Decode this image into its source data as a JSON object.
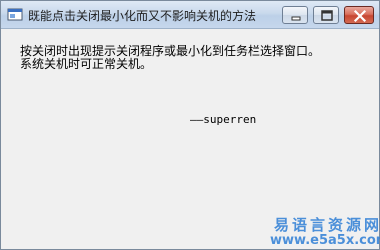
{
  "window": {
    "title": "既能点击关闭最小化而又不影响关机的方法",
    "controls": {
      "minimize": "minimize",
      "maximize": "maximize",
      "close": "close"
    }
  },
  "content": {
    "line1": "按关闭时出现提示关闭程序或最小化到任务栏选择窗口。",
    "line2": "系统关机时可正常关机。",
    "signature": "——superren"
  },
  "watermark": {
    "name": "易语言资源网",
    "url": "www.e5a5x.com"
  },
  "colors": {
    "title_bar": "#c9d9ec",
    "close_button": "#c74632",
    "watermark": "#2f7fd6"
  }
}
